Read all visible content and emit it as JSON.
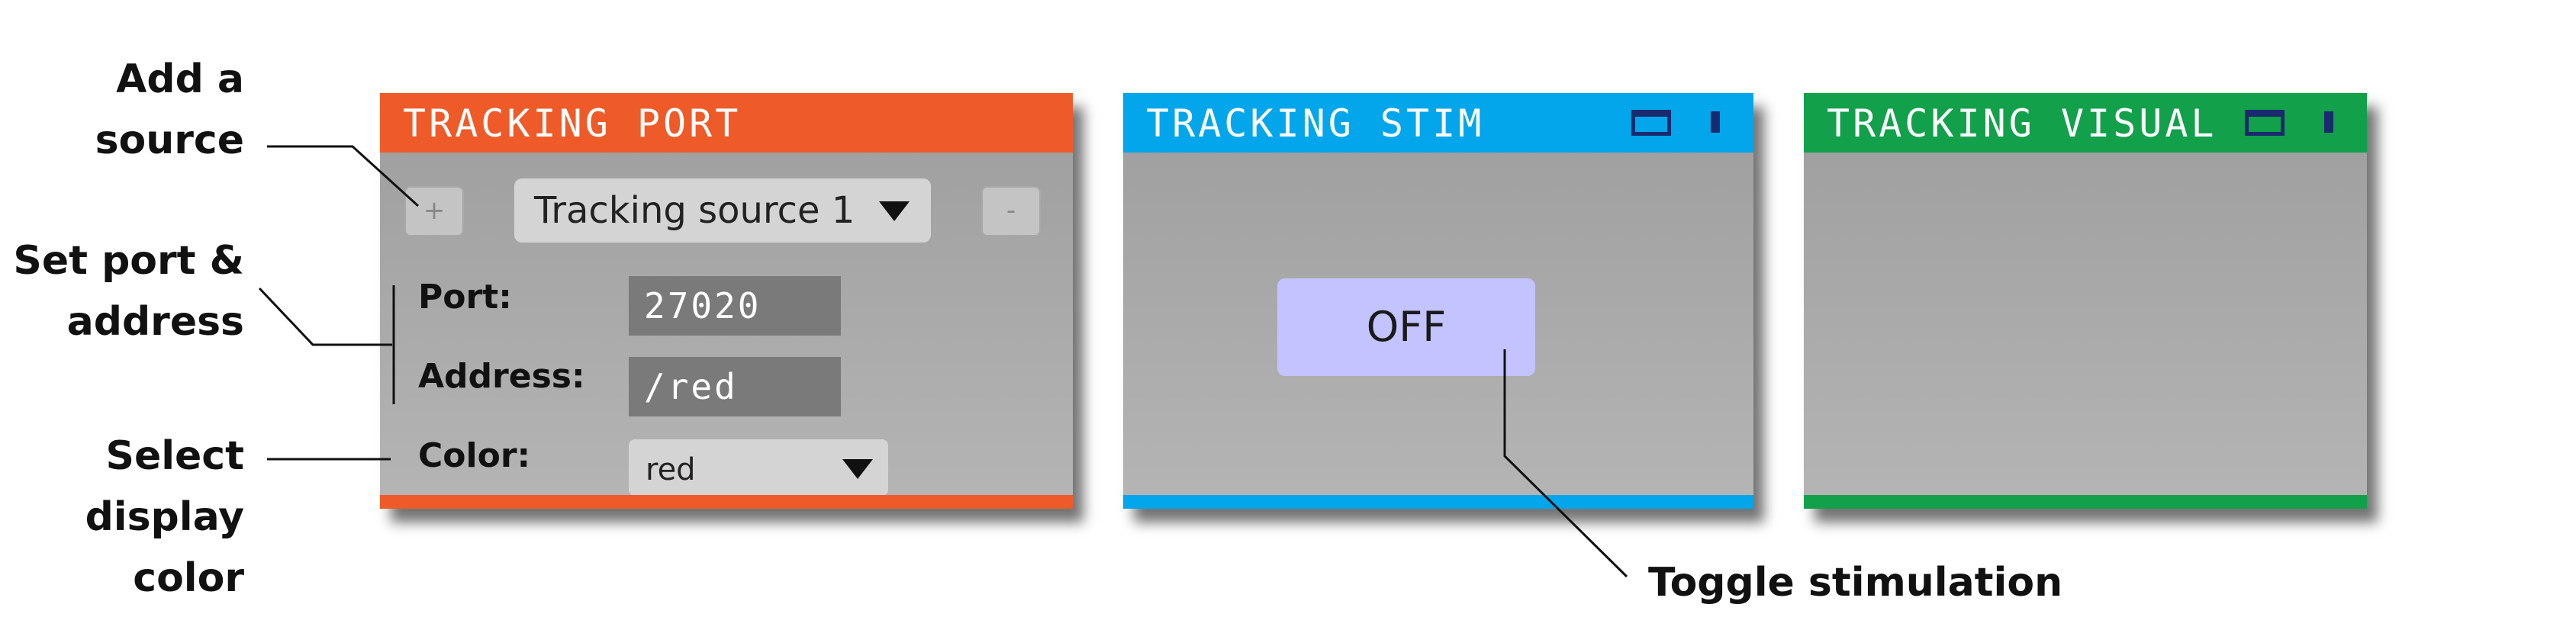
{
  "annotations": {
    "add_source": [
      "Add a",
      "source"
    ],
    "set_port": [
      "Set port &",
      "address"
    ],
    "select_color": [
      "Select",
      "display",
      "color"
    ],
    "toggle": "Toggle stimulation"
  },
  "panels": {
    "tracking_port": {
      "title": "TRACKING PORT",
      "accent": "#ef5a29",
      "add_label": "+",
      "remove_label": "-",
      "source_select": "Tracking source 1",
      "port_label": "Port:",
      "port_value": "27020",
      "address_label": "Address:",
      "address_value": "/red",
      "color_label": "Color:",
      "color_select": "red"
    },
    "tracking_stim": {
      "title": "TRACKING STIM",
      "accent": "#03a6ea",
      "toggle_label": "OFF"
    },
    "tracking_visual": {
      "title": "TRACKING VISUAL",
      "accent": "#12a04b"
    }
  }
}
